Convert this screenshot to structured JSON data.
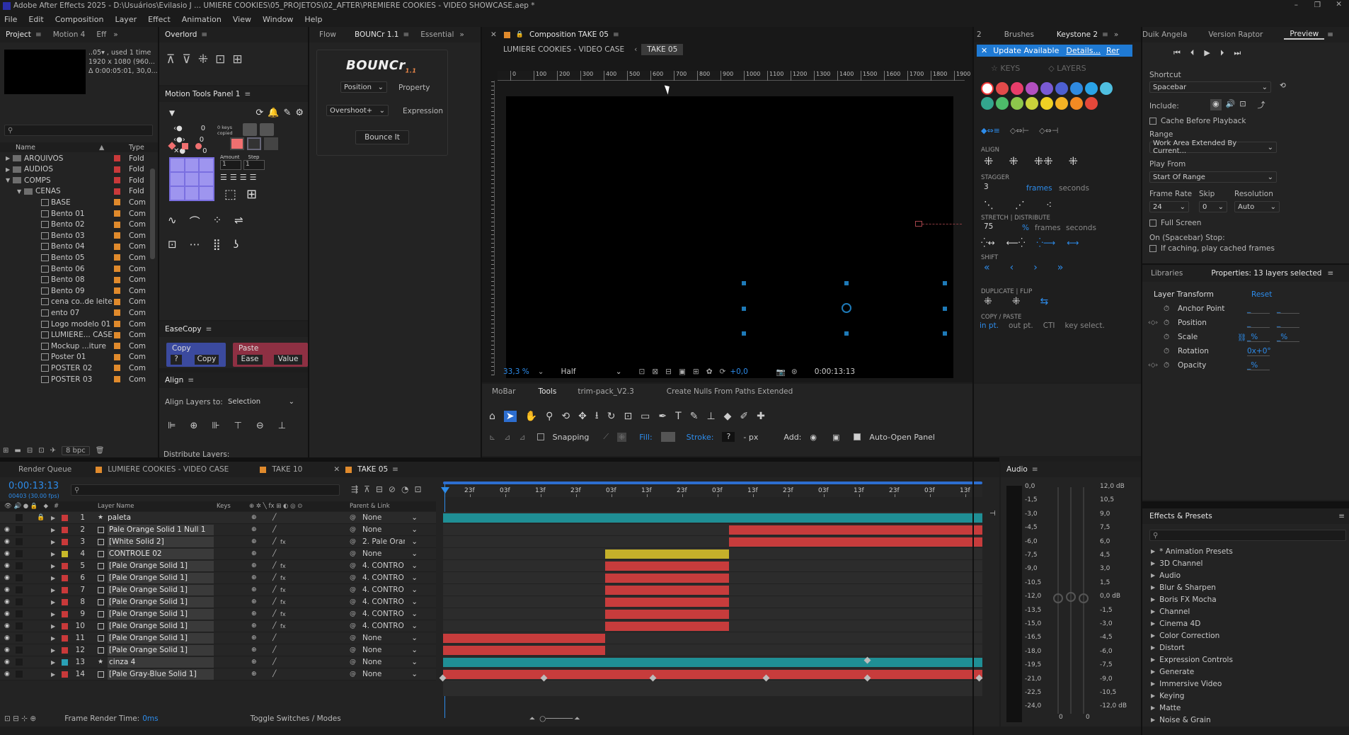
{
  "titlebar": {
    "title": "Adobe After Effects 2025 - D:\\Usuários\\Evilasio J ... UMIERE COOKIES\\05_PROJETOS\\02_AFTER\\PREMIERE COOKIES - VIDEO SHOWCASE.aep *"
  },
  "menu": [
    "File",
    "Edit",
    "Composition",
    "Layer",
    "Effect",
    "Animation",
    "View",
    "Window",
    "Help"
  ],
  "project": {
    "tabs": [
      "Project",
      "Motion 4",
      "Eff"
    ],
    "info": [
      "..05▾ , used 1 time",
      "1920 x 1080 (960...",
      "Δ 0:00:05:01, 30,0..."
    ],
    "search": "",
    "col_name": "Name",
    "col_type": "Type",
    "bpc": "8 bpc",
    "items": [
      {
        "name": "ARQUIVOS",
        "type": "Fold",
        "kind": "folder",
        "depth": 0,
        "color": "#c9393a"
      },
      {
        "name": "AUDIOS",
        "type": "Fold",
        "kind": "folder",
        "depth": 0,
        "color": "#c9393a"
      },
      {
        "name": "COMPS",
        "type": "Fold",
        "kind": "folder",
        "depth": 0,
        "color": "#c9393a"
      },
      {
        "name": "CENAS",
        "type": "Fold",
        "kind": "folder",
        "depth": 1,
        "color": "#c9393a"
      },
      {
        "name": "BASE",
        "type": "Com",
        "kind": "comp",
        "depth": 2,
        "color": "#e08a2c"
      },
      {
        "name": "Bento 01",
        "type": "Com",
        "kind": "comp",
        "depth": 2,
        "color": "#e08a2c"
      },
      {
        "name": "Bento 02",
        "type": "Com",
        "kind": "comp",
        "depth": 2,
        "color": "#e08a2c"
      },
      {
        "name": "Bento 03",
        "type": "Com",
        "kind": "comp",
        "depth": 2,
        "color": "#e08a2c"
      },
      {
        "name": "Bento 04",
        "type": "Com",
        "kind": "comp",
        "depth": 2,
        "color": "#e08a2c"
      },
      {
        "name": "Bento 05",
        "type": "Com",
        "kind": "comp",
        "depth": 2,
        "color": "#e08a2c"
      },
      {
        "name": "Bento 06",
        "type": "Com",
        "kind": "comp",
        "depth": 2,
        "color": "#e08a2c"
      },
      {
        "name": "Bento 08",
        "type": "Com",
        "kind": "comp",
        "depth": 2,
        "color": "#e08a2c"
      },
      {
        "name": "Bento 09",
        "type": "Com",
        "kind": "comp",
        "depth": 2,
        "color": "#e08a2c"
      },
      {
        "name": "cena co..de leite",
        "type": "Com",
        "kind": "comp",
        "depth": 2,
        "color": "#e08a2c"
      },
      {
        "name": "ento 07",
        "type": "Com",
        "kind": "comp",
        "depth": 2,
        "color": "#e08a2c"
      },
      {
        "name": "Logo modelo 01",
        "type": "Com",
        "kind": "comp",
        "depth": 2,
        "color": "#e08a2c"
      },
      {
        "name": "LUMIERE... CASE",
        "type": "Com",
        "kind": "comp",
        "depth": 2,
        "color": "#e08a2c"
      },
      {
        "name": "Mockup ...iture",
        "type": "Com",
        "kind": "comp",
        "depth": 2,
        "color": "#e08a2c"
      },
      {
        "name": "Poster 01",
        "type": "Com",
        "kind": "comp",
        "depth": 2,
        "color": "#e08a2c"
      },
      {
        "name": "POSTER 02",
        "type": "Com",
        "kind": "comp",
        "depth": 2,
        "color": "#e08a2c"
      },
      {
        "name": "POSTER 03",
        "type": "Com",
        "kind": "comp",
        "depth": 2,
        "color": "#e08a2c"
      }
    ]
  },
  "overlord": {
    "tab": "Overlord"
  },
  "motiontools": {
    "tab": "Motion Tools Panel 1",
    "vals": [
      "0",
      "0",
      "0"
    ],
    "keys_copied": "0 keys copied",
    "amount_label": "Amount",
    "step_label": "Step",
    "amount": "1",
    "step": "1"
  },
  "easecopy": {
    "tab": "EaseCopy",
    "copy": "Copy",
    "paste": "Paste",
    "q": "?",
    "copy_btn": "Copy",
    "ease_btn": "Ease",
    "value_btn": "Value"
  },
  "align": {
    "tab": "Align",
    "align_to_label": "Align Layers to:",
    "align_to": "Selection",
    "distribute": "Distribute Layers:"
  },
  "flow": {
    "tabs": [
      "Flow",
      "BOUNCr 1.1",
      "Essential"
    ],
    "logo": "BOUNCr",
    "logo_ver": "1.1",
    "position": "Position",
    "property": "Property",
    "overshoot": "Overshoot+",
    "expression": "Expression",
    "bounce": "Bounce It"
  },
  "composition": {
    "tab": "Composition TAKE 05",
    "crumbs": [
      "LUMIERE COOKIES - VIDEO CASE",
      "TAKE 05"
    ],
    "ruler": [
      "0",
      "100",
      "200",
      "300",
      "400",
      "500",
      "600",
      "700",
      "800",
      "900",
      "1000",
      "1100",
      "1200",
      "1300",
      "1400",
      "1500",
      "1600",
      "1700",
      "1800",
      "1900"
    ],
    "zoom": "33,3 %",
    "resolution": "Half",
    "exposure": "+0,0",
    "timecode": "0:00:13:13"
  },
  "keystone": {
    "tabs": [
      "2",
      "Brushes",
      "Keystone 2"
    ],
    "update": "Update Available",
    "details": "Details...",
    "re": "Rer",
    "keys": "KEYS",
    "layers": "LAYERS",
    "align": "ALIGN",
    "stagger": "STAGGER",
    "stagger_val": "3",
    "frames": "frames",
    "seconds": "seconds",
    "stretch": "STRETCH",
    "distribute": "DISTRIBUTE",
    "stretch_val": "75",
    "pct": "%",
    "shift": "SHIFT",
    "duplicate": "DUPLICATE",
    "flip": "FLIP",
    "copypaste": "COPY / PASTE",
    "in_pt": "in pt.",
    "out_pt": "out pt.",
    "cti": "CTI",
    "key_select": "key select.",
    "colors": [
      "#ffffff",
      "#e34a4a",
      "#e83d6a",
      "#b24fc0",
      "#7a5ad4",
      "#4d5fd1",
      "#2f8ae0",
      "#2aa3e8",
      "#4fbfe0",
      "#33a58d",
      "#4dbb6a",
      "#8dc74c",
      "#c9d23b",
      "#f0d024",
      "#f4b224",
      "#f38a23",
      "#e5483a"
    ]
  },
  "preview": {
    "tabs": [
      "Duik Angela",
      "Version Raptor",
      "Preview"
    ],
    "shortcut_label": "Shortcut",
    "shortcut": "Spacebar",
    "include": "Include:",
    "cache": "Cache Before Playback",
    "range_label": "Range",
    "range": "Work Area Extended By Current...",
    "playfrom_label": "Play From",
    "playfrom": "Start Of Range",
    "framerate_label": "Frame Rate",
    "framerate": "24",
    "skip_label": "Skip",
    "skip": "0",
    "resolution_label": "Resolution",
    "resolution": "Auto",
    "fullscreen": "Full Screen",
    "stop_label": "On (Spacebar) Stop:",
    "stop_opt": "If caching, play cached frames"
  },
  "properties": {
    "tabs": [
      "Libraries",
      "Properties: 13 layers selected"
    ],
    "section": "Layer Transform",
    "reset": "Reset",
    "props": [
      {
        "name": "Anchor Point",
        "v1": "_",
        "v2": "_"
      },
      {
        "name": "Position",
        "v1": "_",
        "v2": "_"
      },
      {
        "name": "Scale",
        "v1": "_%",
        "v2": "_%"
      },
      {
        "name": "Rotation",
        "v1": "0x+0°",
        "v2": ""
      },
      {
        "name": "Opacity",
        "v1": "_%",
        "v2": ""
      }
    ]
  },
  "toolbar": {
    "tabs": [
      "MoBar",
      "Tools",
      "trim-pack_V2.3",
      "Create Nulls From Paths Extended"
    ],
    "snapping": "Snapping",
    "fill": "Fill:",
    "stroke": "Stroke:",
    "stroke_val": "?",
    "px": "- px",
    "add": "Add:",
    "auto_open": "Auto-Open Panel"
  },
  "timeline": {
    "tabs": [
      "Render Queue",
      "LUMIERE COOKIES - VIDEO CASE",
      "TAKE 10",
      "TAKE 05"
    ],
    "timecode": "0:00:13:13",
    "fps": "00403 (30.00 fps)",
    "search": "",
    "col_layer": "Layer Name",
    "col_keys": "Keys",
    "col_parent": "Parent & Link",
    "ruler": [
      "23f",
      "03f",
      "13f",
      "23f",
      "03f",
      "13f",
      "23f",
      "03f",
      "13f",
      "23f",
      "03f",
      "13f",
      "23f",
      "03f",
      "13f"
    ],
    "render_time_label": "Frame Render Time:",
    "render_time": "0ms",
    "toggle": "Toggle Switches / Modes",
    "layers": [
      {
        "num": "1",
        "name": "paleta",
        "color": "#c9393a",
        "parent": "None",
        "star": true,
        "bar": {
          "s": 0,
          "e": 1,
          "c": "#1f8f95"
        }
      },
      {
        "num": "2",
        "name": "Pale Orange Solid 1 Null 1",
        "color": "#c9393a",
        "parent": "None",
        "bar": {
          "s": 0.53,
          "e": 1,
          "c": "#c73c3c"
        }
      },
      {
        "num": "3",
        "name": "[White Solid 2]",
        "color": "#c9393a",
        "parent": "2. Pale Oran",
        "bar": {
          "s": 0.53,
          "e": 1,
          "c": "#c73c3c"
        }
      },
      {
        "num": "4",
        "name": "CONTROLE 02",
        "color": "#c8b92a",
        "parent": "None",
        "bar": {
          "s": 0.3,
          "e": 0.53,
          "c": "#c5b02a"
        }
      },
      {
        "num": "5",
        "name": "[Pale Orange Solid 1]",
        "color": "#c9393a",
        "parent": "4. CONTRO",
        "bar": {
          "s": 0.3,
          "e": 0.53,
          "c": "#c73c3c"
        }
      },
      {
        "num": "6",
        "name": "[Pale Orange Solid 1]",
        "color": "#c9393a",
        "parent": "4. CONTRO",
        "bar": {
          "s": 0.3,
          "e": 0.53,
          "c": "#c73c3c"
        }
      },
      {
        "num": "7",
        "name": "[Pale Orange Solid 1]",
        "color": "#c9393a",
        "parent": "4. CONTRO",
        "bar": {
          "s": 0.3,
          "e": 0.53,
          "c": "#c73c3c"
        }
      },
      {
        "num": "8",
        "name": "[Pale Orange Solid 1]",
        "color": "#c9393a",
        "parent": "4. CONTRO",
        "bar": {
          "s": 0.3,
          "e": 0.53,
          "c": "#c73c3c"
        }
      },
      {
        "num": "9",
        "name": "[Pale Orange Solid 1]",
        "color": "#c9393a",
        "parent": "4. CONTRO",
        "bar": {
          "s": 0.3,
          "e": 0.53,
          "c": "#c73c3c"
        }
      },
      {
        "num": "10",
        "name": "[Pale Orange Solid 1]",
        "color": "#c9393a",
        "parent": "4. CONTRO",
        "bar": {
          "s": 0.3,
          "e": 0.53,
          "c": "#c73c3c"
        }
      },
      {
        "num": "11",
        "name": "[Pale Orange Solid 1]",
        "color": "#c9393a",
        "parent": "None",
        "bar": {
          "s": 0,
          "e": 0.3,
          "c": "#c73c3c"
        }
      },
      {
        "num": "12",
        "name": "[Pale Orange Solid 1]",
        "color": "#c9393a",
        "parent": "None",
        "bar": {
          "s": 0,
          "e": 0.3,
          "c": "#c73c3c"
        }
      },
      {
        "num": "13",
        "name": "cinza 4",
        "color": "#2aa0b5",
        "parent": "None",
        "star": true,
        "bar": {
          "s": 0,
          "e": 1,
          "c": "#1f8f95"
        }
      },
      {
        "num": "14",
        "name": "[Pale Gray-Blue Solid 1]",
        "color": "#c9393a",
        "parent": "None",
        "bar": {
          "s": 0,
          "e": 1,
          "c": "#c73c3c"
        }
      }
    ]
  },
  "audio": {
    "tab": "Audio",
    "left": [
      "0,0",
      "-1,5",
      "-3,0",
      "-4,5",
      "-6,0",
      "-7,5",
      "-9,0",
      "-10,5",
      "-12,0",
      "-13,5",
      "-15,0",
      "-16,5",
      "-18,0",
      "-19,5",
      "-21,0",
      "-22,5",
      "-24,0"
    ],
    "right": [
      "12,0 dB",
      "10,5",
      "9,0",
      "7,5",
      "6,0",
      "4,5",
      "3,0",
      "1,5",
      "0,0 dB",
      "-1,5",
      "-3,0",
      "-4,5",
      "-6,0",
      "-7,5",
      "-9,0",
      "-10,5",
      "-12,0 dB"
    ],
    "zero1": "0",
    "zero2": "0"
  },
  "effects": {
    "tab": "Effects & Presets",
    "items": [
      "* Animation Presets",
      "3D Channel",
      "Audio",
      "Blur & Sharpen",
      "Boris FX Mocha",
      "Channel",
      "Cinema 4D",
      "Color Correction",
      "Distort",
      "Expression Controls",
      "Generate",
      "Immersive Video",
      "Keying",
      "Matte",
      "Noise & Grain"
    ]
  }
}
